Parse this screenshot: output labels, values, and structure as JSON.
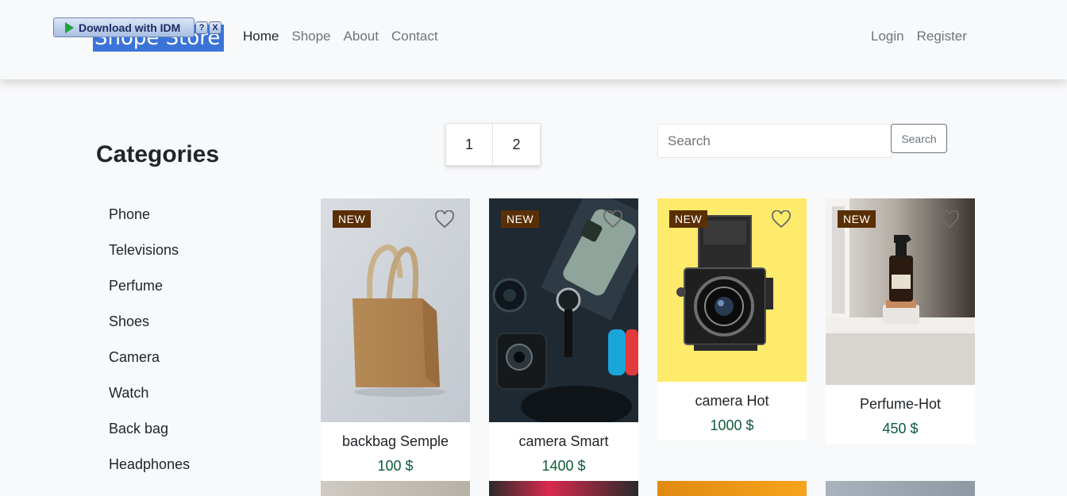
{
  "navbar": {
    "brand": "Shope Store",
    "idm": {
      "label": "Download with IDM",
      "help": "?",
      "close": "X"
    },
    "links": [
      "Home",
      "Shope",
      "About",
      "Contact"
    ],
    "auth": [
      "Login",
      "Register"
    ]
  },
  "categories": {
    "title": "Categories",
    "items": [
      "Phone",
      "Televisions",
      "Perfume",
      "Shoes",
      "Camera",
      "Watch",
      "Back bag",
      "Headphones"
    ]
  },
  "pagination": {
    "pages": [
      "1",
      "2"
    ]
  },
  "search": {
    "placeholder": "Search",
    "button": "Search"
  },
  "products": [
    {
      "badge": "NEW",
      "name": "backbag Semple",
      "price": "100 $",
      "image": "tote-bag-photo"
    },
    {
      "badge": "NEW",
      "name": "camera Smart",
      "price": "1400 $",
      "image": "gadgets-flatlay-photo"
    },
    {
      "badge": "NEW",
      "name": "camera Hot",
      "price": "1000 $",
      "image": "bronica-camera-photo"
    },
    {
      "badge": "NEW",
      "name": "Perfume-Hot",
      "price": "450 $",
      "image": "perfume-bottle-photo"
    }
  ],
  "colors": {
    "badge": "#5a2f05",
    "price": "#0e5b3a",
    "brand_bg": "#3a74d9"
  }
}
